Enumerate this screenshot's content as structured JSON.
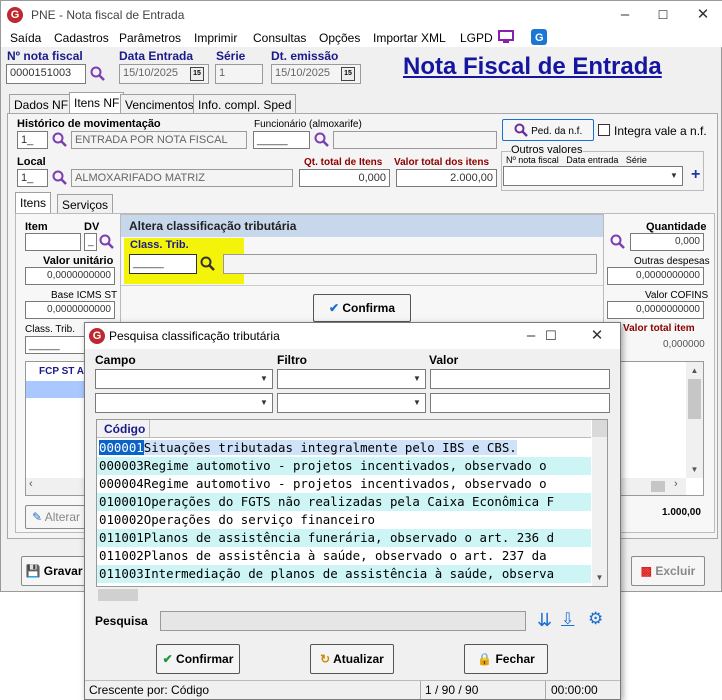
{
  "window": {
    "title": "PNE - Nota fiscal de Entrada"
  },
  "menu": [
    "Saída",
    "Cadastros",
    "Parâmetros",
    "Imprimir",
    "Consultas",
    "Opções",
    "Importar XML",
    "LGPD"
  ],
  "header": {
    "nota_label": "Nº nota fiscal",
    "nota_value": "0000151003",
    "data_entrada_label": "Data Entrada",
    "data_entrada_value": "15/10/2025",
    "serie_label": "Série",
    "serie_value": "1",
    "dt_emissao_label": "Dt. emissão",
    "dt_emissao_value": "15/10/2025",
    "big_title": "Nota Fiscal de Entrada"
  },
  "tabs": [
    "Dados NF",
    "Itens NF",
    "Vencimentos",
    "Info. compl. Sped"
  ],
  "itens_nf": {
    "historico_label": "Histórico de movimentação",
    "historico_code": "1_",
    "historico_desc": "ENTRADA POR NOTA FISCAL",
    "funcionario_label": "Funcionário (almoxarife)",
    "funcionario_value": "_____",
    "ped_nf_label": "Ped. da n.f.",
    "integra_label": "Integra vale a n.f.",
    "local_label": "Local",
    "local_code": "1_",
    "local_desc": "ALMOXARIFADO MATRIZ",
    "qt_total_label": "Qt. total de Itens",
    "qt_total_value": "0,000",
    "valor_total_label": "Valor total dos itens",
    "valor_total_value": "2.000,00",
    "outros_label": "Outros valores",
    "outros_cols": "Nº nota fiscal   Data entrada   Série"
  },
  "sub_tabs": [
    "Itens",
    "Serviços"
  ],
  "item_panel": {
    "item_label": "Item",
    "dv_label": "DV",
    "dv_value": "_",
    "valor_unitario_label": "Valor unitário",
    "valor_unitario_value": "0,0000000000",
    "base_icms_st_label": "Base ICMS ST",
    "base_icms_st_value": "0,0000000000",
    "class_trib_label": "Class. Trib.",
    "class_trib_value": "_____",
    "quantidade_label": "Quantidade",
    "quantidade_value": "0,000",
    "outras_despesas_label": "Outras despesas",
    "outras_despesas_value": "0,0000000000",
    "valor_cofins_label": "Valor COFINS",
    "valor_cofins_value": "0,0000000000",
    "valor_total_item_label": "Valor total item",
    "valor_total_item_value": "0,000000",
    "grid_header": "FCP ST Alic",
    "grid_total": "1.000,00",
    "alterar_label": "Alterar",
    "gravar_label": "Gravar",
    "excluir_label": "Excluir"
  },
  "altera_popup": {
    "title": "Altera classificação tributária",
    "class_trib_label": "Class. Trib.",
    "class_trib_value": "_____",
    "confirma_label": "Confirma"
  },
  "dialog": {
    "title": "Pesquisa classificação tributária",
    "campo_label": "Campo",
    "filtro_label": "Filtro",
    "valor_label": "Valor",
    "col_codigo": "Código",
    "rows": [
      {
        "codigo": "000001",
        "descricao": "Situações tributadas integralmente pelo IBS e CBS."
      },
      {
        "codigo": "000003",
        "descricao": "Regime automotivo - projetos incentivados, observado o"
      },
      {
        "codigo": "000004",
        "descricao": "Regime automotivo - projetos incentivados, observado o"
      },
      {
        "codigo": "010001",
        "descricao": "Operações do FGTS não realizadas pela Caixa Econômica F"
      },
      {
        "codigo": "010002",
        "descricao": "Operações do serviço financeiro"
      },
      {
        "codigo": "011001",
        "descricao": "Planos de assistência funerária, observado o art. 236 d"
      },
      {
        "codigo": "011002",
        "descricao": "Planos de assistência à saúde, observado o art. 237 da"
      },
      {
        "codigo": "011003",
        "descricao": "Intermediação de planos de assistência à saúde, observa"
      }
    ],
    "pesquisa_label": "Pesquisa",
    "confirmar_label": "Confirmar",
    "atualizar_label": "Atualizar",
    "fechar_label": "Fechar",
    "status_order": "Crescente por: Código",
    "status_count": "1 / 90 / 90",
    "status_time": "00:00:00"
  },
  "colors": {
    "accent": "#0a63c9",
    "row_cyan": "#cdf5f5",
    "row_selected": "#0a63c9",
    "title_blue": "#1515a0",
    "highlight_yellow": "#f4f40a"
  }
}
